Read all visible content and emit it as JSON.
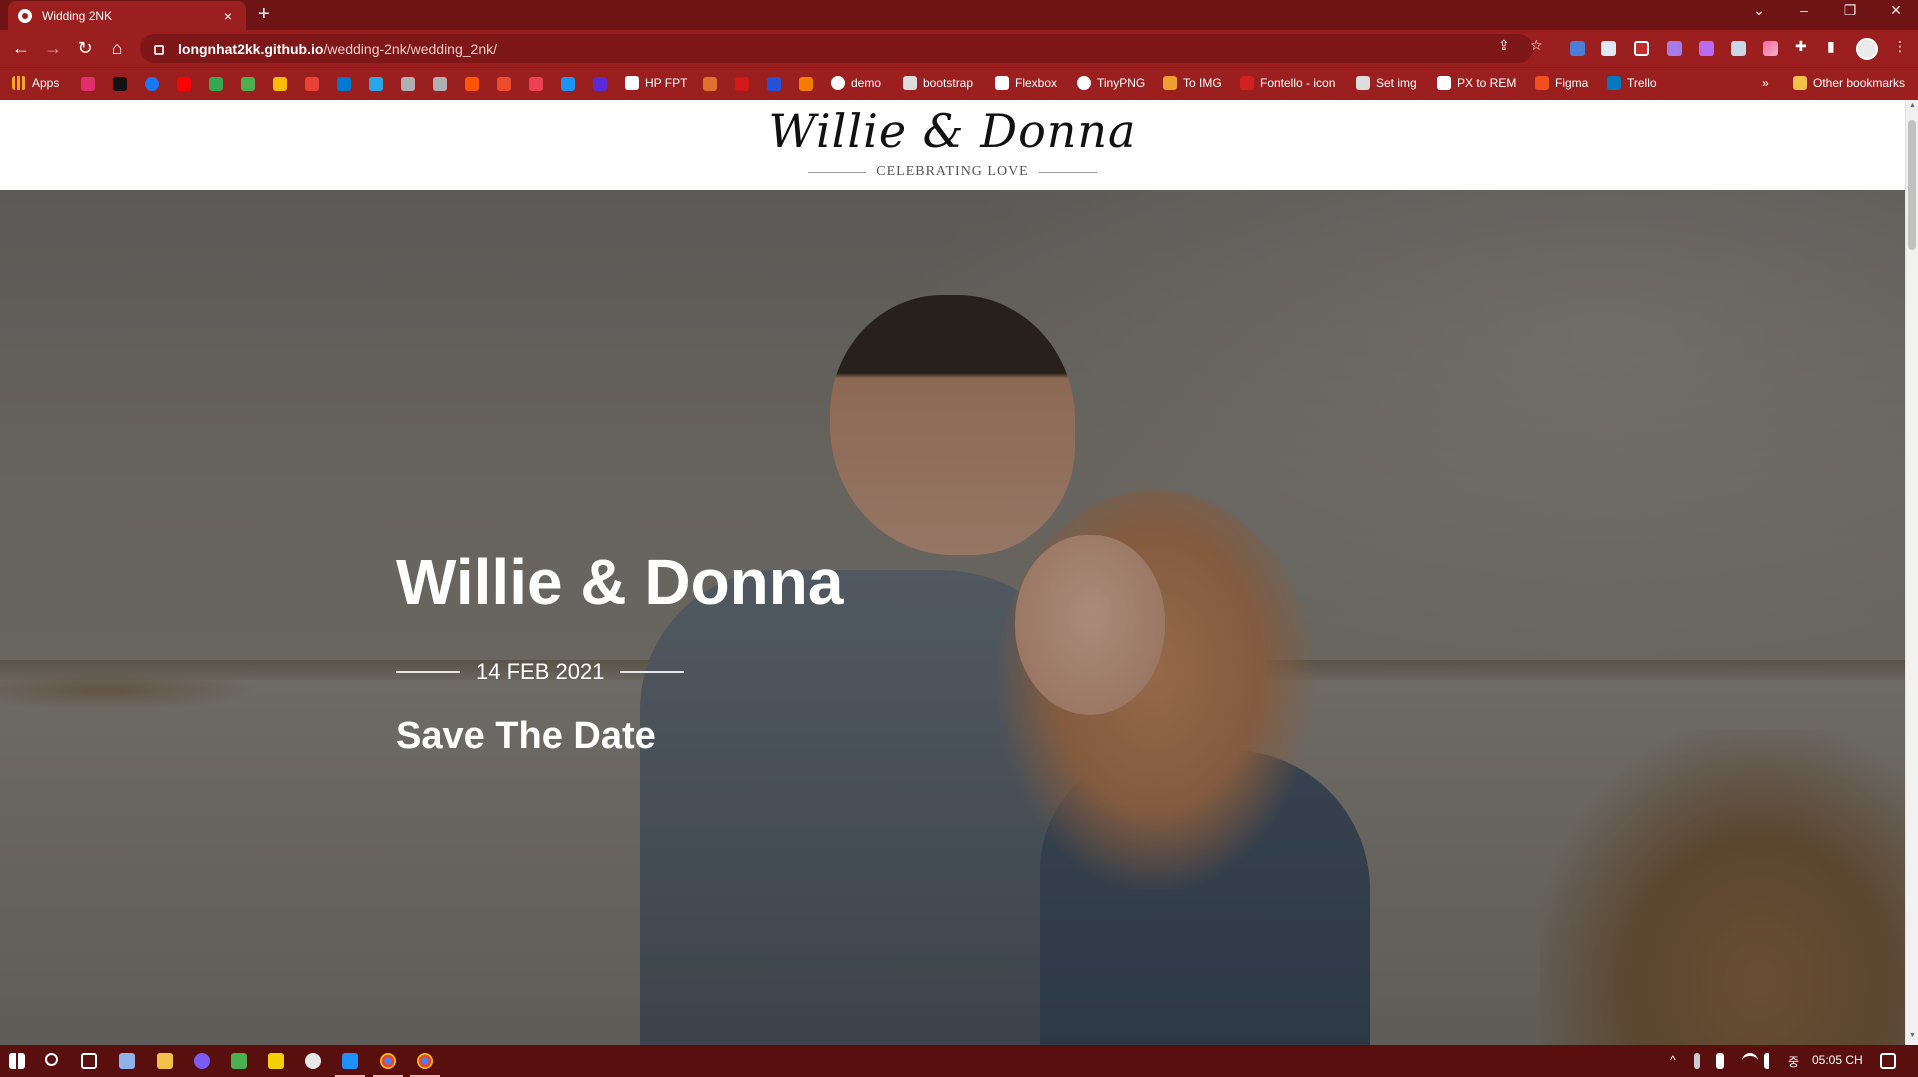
{
  "browser": {
    "tab_title": "Widding 2NK",
    "tab_close": "×",
    "new_tab": "+",
    "url_host": "longnhat2kk.github.io",
    "url_path": "/wedding-2nk/wedding_2nk/",
    "controls": {
      "minimize": "–",
      "restore": "❐",
      "close": "✕",
      "tab_search": "⌄"
    },
    "nav": {
      "back": "←",
      "forward": "→",
      "reload": "↻",
      "home": "⌂"
    },
    "omni_icons": {
      "share": "⇪",
      "star": "☆"
    },
    "toolbar_icons": {
      "extensions": "✚",
      "sidepanel": "▮",
      "menu": "⋮"
    }
  },
  "bookmarks": {
    "apps": "Apps",
    "items": [
      {
        "label": "HP FPT",
        "color": "#ffffff"
      },
      {
        "label": "demo",
        "color": "#ffffff"
      },
      {
        "label": "bootstrap",
        "color": "#dddddd"
      },
      {
        "label": "Flexbox",
        "color": "#ffffff"
      },
      {
        "label": "TinyPNG",
        "color": "#ffffff"
      },
      {
        "label": "To IMG",
        "color": "#f0a030"
      },
      {
        "label": "Fontello - icon",
        "color": "#d02020"
      },
      {
        "label": "Set img",
        "color": "#dddddd"
      },
      {
        "label": "PX to REM",
        "color": "#ffffff"
      },
      {
        "label": "Figma",
        "color": "#f24e1e"
      },
      {
        "label": "Trello",
        "color": "#0079bf"
      }
    ],
    "more": "»",
    "other": "Other bookmarks"
  },
  "site": {
    "logo": "Willie & Donna",
    "tagline": "CELEBRATING LOVE"
  },
  "hero": {
    "title": "Willie & Donna",
    "date": "14 FEB 2021",
    "subtitle": "Save The Date"
  },
  "taskbar": {
    "time": "05:05 CH",
    "tray_lang": "중",
    "tray_caret": "^"
  }
}
